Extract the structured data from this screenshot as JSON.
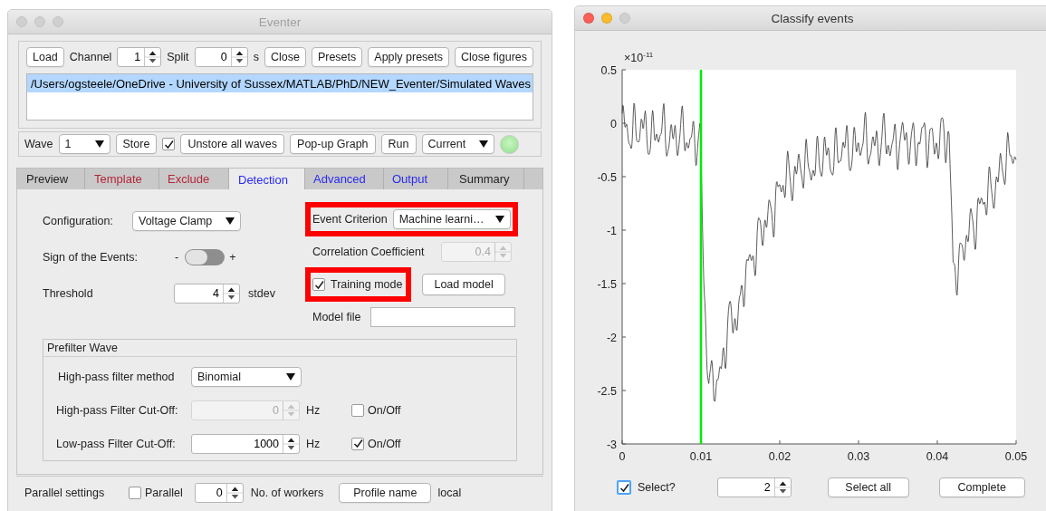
{
  "eventer": {
    "title": "Eventer",
    "active": false,
    "toolbar": [
      {
        "kind": "button",
        "label": "Load"
      },
      {
        "kind": "spinner",
        "label": "Channel",
        "value": "1"
      },
      {
        "kind": "spinner",
        "label": "Split",
        "value": "0",
        "unit": "s"
      },
      {
        "kind": "button",
        "label": "Close"
      },
      {
        "kind": "button",
        "label": "Presets"
      },
      {
        "kind": "button",
        "label": "Apply presets"
      },
      {
        "kind": "button",
        "label": "Close figures"
      }
    ],
    "files": [
      {
        "path": "/Users/ogsteele/OneDrive - University of Sussex/MATLAB/PhD/NEW_Eventer/Simulated Waves",
        "selected": true
      }
    ],
    "wave_row": [
      {
        "kind": "dropdown",
        "label": "Wave",
        "value": "1"
      },
      {
        "kind": "button",
        "label": "Store"
      },
      {
        "kind": "checkbox",
        "checked": true
      },
      {
        "kind": "button",
        "label": "Unstore all waves"
      },
      {
        "kind": "button",
        "label": "Pop-up Graph"
      },
      {
        "kind": "button",
        "label": "Run"
      },
      {
        "kind": "dropdown",
        "value": "Current"
      },
      {
        "kind": "lamp",
        "on": true
      }
    ],
    "tabs": [
      {
        "label": "Preview",
        "selected": false,
        "color": "#222222"
      },
      {
        "label": "Template",
        "selected": false,
        "color": "#b3263a"
      },
      {
        "label": "Exclude",
        "selected": false,
        "color": "#b3263a"
      },
      {
        "label": "Detection",
        "selected": true,
        "color": "#2a2af0"
      },
      {
        "label": "Advanced",
        "selected": false,
        "color": "#2a2af0"
      },
      {
        "label": "Output",
        "selected": false,
        "color": "#2a2af0"
      },
      {
        "label": "Summary",
        "selected": false,
        "color": "#222222"
      }
    ],
    "detection": {
      "left": [
        {
          "kind": "dropdown",
          "label": "Configuration:",
          "value": "Voltage Clamp"
        },
        {
          "kind": "switch",
          "label": "Sign of the Events:",
          "off_label": "-",
          "on_label": "+",
          "on": false
        },
        {
          "kind": "spinner",
          "label": "Threshold",
          "value": "4",
          "unit": "stdev"
        }
      ],
      "right": [
        {
          "kind": "dropdown",
          "label": "Event Criterion",
          "value": "Machine learni…",
          "highlighted": true
        },
        {
          "kind": "spinner",
          "label": "Correlation Coefficient",
          "value": "0.4",
          "disabled": true,
          "highlighted": false
        },
        {
          "kind": "checkbox",
          "label": "Training mode",
          "checked": true,
          "highlighted": true,
          "button": "Load model"
        },
        {
          "kind": "text_field",
          "label": "Model file",
          "highlighted": false
        }
      ]
    },
    "prefilter": {
      "title": "Prefilter Wave",
      "method": {
        "label": "High-pass filter method",
        "value": "Binomial"
      },
      "filters": [
        {
          "label": "High-pass Filter Cut-Off:",
          "value": "0",
          "unit": "Hz",
          "disabled": true,
          "toggle": {
            "label": "On/Off",
            "checked": false
          }
        },
        {
          "label": "Low-pass Filter Cut-Off:",
          "value": "1000",
          "unit": "Hz",
          "disabled": false,
          "toggle": {
            "label": "On/Off",
            "checked": true
          }
        }
      ]
    },
    "parallel": {
      "label": "Parallel settings",
      "checkbox": {
        "label": "Parallel",
        "checked": false
      },
      "workers": {
        "value": "0",
        "label": "No. of workers"
      },
      "button": "Profile name",
      "profile": "local"
    }
  },
  "classify": {
    "title": "Classify events",
    "active": true,
    "plot": {
      "exponent": "×10$^{-11}$",
      "yticks": [
        "0.5",
        "0",
        "-0.5",
        "-1",
        "-1.5",
        "-2",
        "-2.5",
        "-3"
      ],
      "xticks": [
        "0",
        "0.01",
        "0.02",
        "0.03",
        "0.04",
        "0.05"
      ],
      "marker": {
        "level": 0.2
      }
    },
    "select": {
      "label": "Select?",
      "checked": true
    },
    "event_number": "2",
    "buttons": [
      "Select all",
      "Complete"
    ]
  }
}
